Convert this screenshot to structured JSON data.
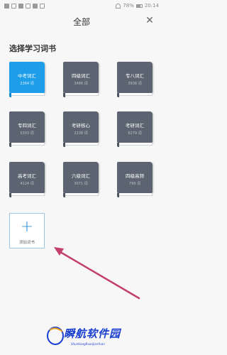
{
  "status_bar": {
    "battery": "78%",
    "time": "20:14"
  },
  "header": {
    "title": "全部",
    "close_glyph": "✕"
  },
  "section_title": "选择学习词书",
  "books": [
    {
      "name": "中考词汇",
      "count": "2364 词",
      "selected": true
    },
    {
      "name": "四级词汇",
      "count": "3486 词",
      "selected": false
    },
    {
      "name": "专八词汇",
      "count": "3938 词",
      "selected": false
    },
    {
      "name": "专四词汇",
      "count": "5303 词",
      "selected": false
    },
    {
      "name": "考研核心",
      "count": "2238 词",
      "selected": false
    },
    {
      "name": "考研词汇",
      "count": "6279 词",
      "selected": false
    },
    {
      "name": "高考词汇",
      "count": "4124 词",
      "selected": false
    },
    {
      "name": "六级词汇",
      "count": "3071 词",
      "selected": false
    },
    {
      "name": "四级高频",
      "count": "799 词",
      "selected": false
    }
  ],
  "add_book": {
    "plus": "+",
    "label": "添加词书"
  },
  "watermark": {
    "text": "瞬航软件园",
    "sub": "ShunHangRuanJianYuan"
  },
  "colors": {
    "accent": "#1e9ee8",
    "book": "#5b6470",
    "arrow": "#c2406a"
  }
}
